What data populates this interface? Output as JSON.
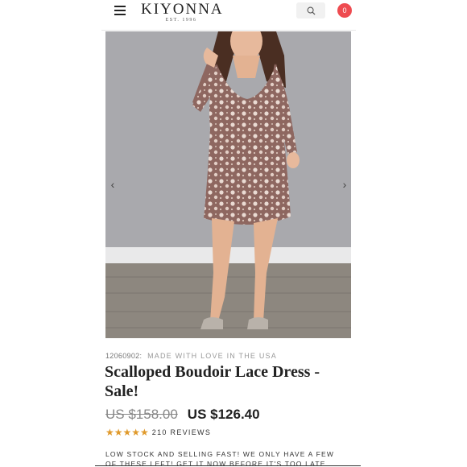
{
  "header": {
    "logo_text": "KIYONNA",
    "logo_est": "EST. 1996",
    "cart_count": "0"
  },
  "product": {
    "sku": "12060902",
    "sku_separator": ":",
    "made_in": "MADE WITH LOVE IN THE USA",
    "title": "Scalloped Boudoir Lace Dress - Sale!",
    "price_original": "US $158.00",
    "price_sale": "US $126.40",
    "rating": 5,
    "stars": "★★★★★",
    "reviews": "210 REVIEWS",
    "stock_message": "LOW STOCK AND SELLING FAST! WE ONLY HAVE A FEW OF THESE LEFT! GET IT NOW BEFORE IT'S TOO LATE."
  },
  "colors": {
    "cart_badge": "#ee4b50",
    "star": "#e09a2c",
    "wall": "#a9a9ad",
    "floor": "#8d877f",
    "lace": "#8e6760"
  },
  "icons": {
    "menu": "hamburger-icon",
    "search": "search-icon",
    "prev": "chevron-left-icon",
    "next": "chevron-right-icon"
  }
}
